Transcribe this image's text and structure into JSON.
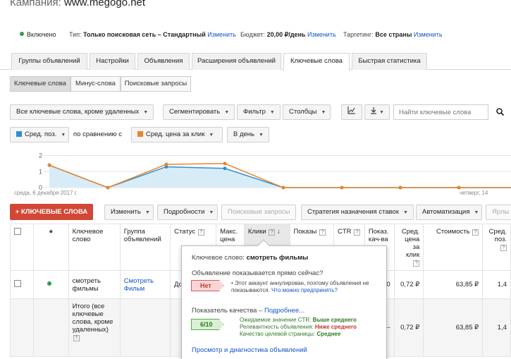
{
  "campaign": {
    "label": "Кампания:",
    "name": "www.megogo.net"
  },
  "status": {
    "state": "Включено",
    "type_label": "Тип:",
    "type_value": "Только поисковая сеть – Стандартный",
    "type_link": "Изменить",
    "budget_label": "Бюджет:",
    "budget_value": "20,00 ₽/день",
    "budget_link": "Изменить",
    "targeting_label": "Таргетинг:",
    "targeting_value": "Все страны",
    "targeting_link": "Изменить"
  },
  "tabs": [
    "Группы объявлений",
    "Настройки",
    "Объявления",
    "Расширения объявлений",
    "Ключевые слова",
    "Быстрая статистика"
  ],
  "subtabs": [
    "Ключевые слова",
    "Минус-слова",
    "Поисковые запросы"
  ],
  "toolbar": {
    "filter_all": "Все ключевые слова, кроме удаленных",
    "segment": "Сегментировать",
    "filter": "Фильтр",
    "columns": "Столбцы",
    "search_placeholder": "Найти ключевые слова"
  },
  "chart_controls": {
    "metric1": "Сред. поз.",
    "compare": "по сравнению с",
    "metric2": "Сред. цена за клик",
    "period": "В день"
  },
  "colors": {
    "series1": "#2d8fd5",
    "series2": "#e8862b",
    "accent_red": "#d14836",
    "link": "#1155cc"
  },
  "chart_data": {
    "type": "line",
    "x": [
      "среда, 6 декабря 2017 г.",
      "",
      "",
      "",
      "",
      "",
      "",
      "",
      "четверг, 14 декабря 2017 г."
    ],
    "yticks": [
      0,
      1,
      2
    ],
    "ylim": [
      0,
      2.2
    ],
    "series": [
      {
        "name": "Сред. поз.",
        "values": [
          1.4,
          0,
          1.3,
          1.2,
          0,
          0,
          0,
          0,
          0
        ]
      },
      {
        "name": "Сред. цена за клик",
        "values": [
          1.4,
          0,
          1.45,
          1.5,
          0,
          0,
          0,
          0,
          0
        ]
      }
    ],
    "x_start_label": "среда, 6 декабря 2017 г.",
    "x_end_label": "четверг, 14"
  },
  "actions": {
    "add_keywords": "+ КЛЮЧЕВЫЕ СЛОВА",
    "edit": "Изменить",
    "details": "Подробности",
    "search_terms": "Поисковые запросы",
    "bid_strategy": "Стратегия назначения ставок",
    "automation": "Автоматизация",
    "labels": "Ярлы"
  },
  "table": {
    "headers": {
      "keyword": "Ключевое слово",
      "adgroup": "Группа объявлений",
      "status": "Статус",
      "maxcpc": "Макс. цена",
      "clicks": "Клики",
      "impr": "Показы",
      "ctr": "CTR",
      "impr_share": "Показ. кач-ва",
      "avg_cpc": "Сред. цена за клик",
      "cost": "Стоимость",
      "avg_pos": "Сред. поз."
    },
    "rows": [
      {
        "keyword": "смотреть фильмы",
        "adgroup": "Смотреть Фильм",
        "status": "До",
        "impr_share": "0",
        "avg_cpc": "0,72 ₽",
        "cost": "63,85 ₽",
        "avg_pos": "1,4"
      },
      {
        "keyword": "Итого (все ключевые слова, кроме удаленных)",
        "impr_share": "--",
        "avg_cpc": "0,72 ₽",
        "cost": "63,85 ₽",
        "avg_pos": "1,4"
      }
    ]
  },
  "popup": {
    "keyword_label": "Ключевое слово:",
    "keyword_value": "смотреть фильмы",
    "showing_question": "Объявление показывается прямо сейчас?",
    "showing_answer": "Нет",
    "showing_note": "Этот аккаунт аннулирован, поэтому объявления не показываются.",
    "showing_link": "Что можно предпринять?",
    "quality_label": "Показатель качества –",
    "quality_link": "Подробнее...",
    "quality_score": "6/10",
    "ctr_label": "Ожидаемое значение CTR:",
    "ctr_value": "Выше среднего",
    "relevance_label": "Релевантность объявления:",
    "relevance_value": "Ниже среднего",
    "landing_label": "Качество целевой страницы:",
    "landing_value": "Среднее",
    "diag_link": "Просмотр и диагностика объявлений"
  }
}
